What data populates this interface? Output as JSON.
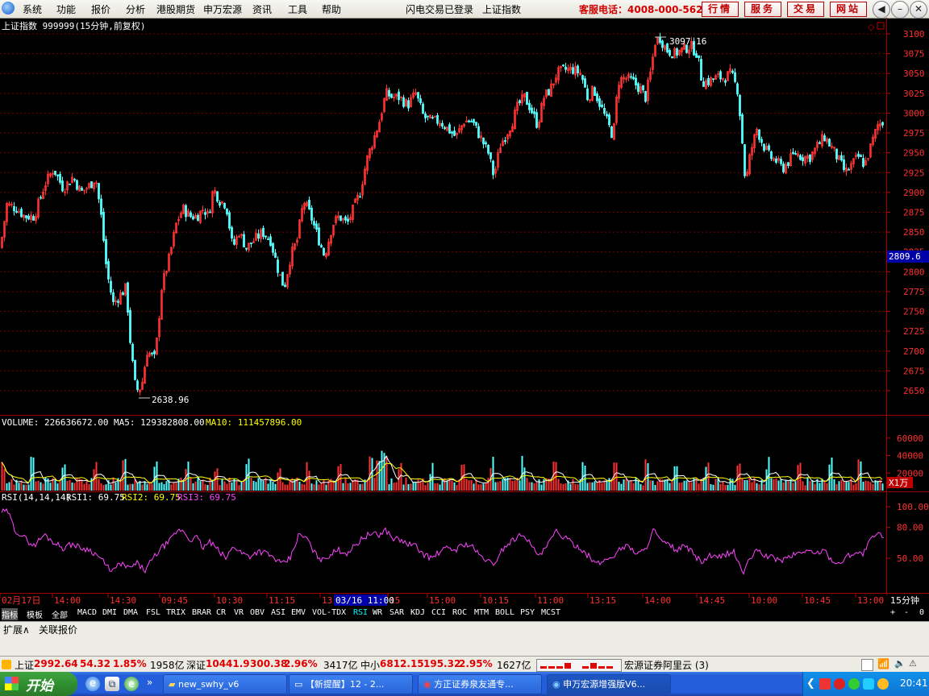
{
  "menubar": {
    "items": [
      "系统",
      "功能",
      "报价",
      "分析",
      "港股期货",
      "申万宏源",
      "资讯",
      "工具",
      "帮助"
    ],
    "flash_login": "闪电交易已登录",
    "index_name": "上证指数",
    "hotline": "客服电话：4008-000-562",
    "buttons": [
      "行情",
      "服务",
      "交易",
      "网站"
    ]
  },
  "price_panel": {
    "title": "上证指数 999999(15分钟,前复权)",
    "high_label": "3097.16",
    "low_label": "2638.96",
    "cursor_price": "2809.6",
    "y_ticks": [
      "3100",
      "3075",
      "3050",
      "3025",
      "3000",
      "2975",
      "2950",
      "2925",
      "2900",
      "2875",
      "2850",
      "2825",
      "2800",
      "2775",
      "2750",
      "2725",
      "2700",
      "2675",
      "2650"
    ]
  },
  "volume_panel": {
    "label_volume": "VOLUME: 226636672.00",
    "label_ma5": "MA5: 129382808.00",
    "label_ma10": "MA10: 111457896.00",
    "y_ticks": [
      "60000",
      "40000",
      "20000"
    ],
    "unit": "X1万"
  },
  "rsi_panel": {
    "label_params": "RSI(14,14,14)",
    "label_rsi1": "RSI1: 69.75",
    "label_rsi2": "RSI2: 69.75",
    "label_rsi3": "RSI3: 69.75",
    "y_ticks": [
      "100.00",
      "80.00",
      "50.00"
    ]
  },
  "time_axis": {
    "labels": [
      "02月17日",
      "14:00",
      "14:30",
      "09:45",
      "10:30",
      "11:15",
      "13",
      "15",
      "15:00",
      "10:15",
      "11:00",
      "13:15",
      "14:00",
      "14:45",
      "10:00",
      "10:45",
      "13:00"
    ],
    "cursor_time": "03/16 11:00",
    "period": "15分钟"
  },
  "indicator_tabs": [
    "指标",
    "模板",
    "全部",
    "MACD",
    "DMI",
    "DMA",
    "FSL",
    "TRIX",
    "BRAR",
    "CR",
    "VR",
    "OBV",
    "ASI",
    "EMV",
    "VOL-TDX",
    "RSI",
    "WR",
    "SAR",
    "KDJ",
    "CCI",
    "ROC",
    "MTM",
    "BOLL",
    "PSY",
    "MCST"
  ],
  "tab_controls": [
    "+",
    "-",
    "0"
  ],
  "ext_bar": [
    "扩展∧",
    "关联报价"
  ],
  "status_bar": {
    "sh_name": "上证",
    "sh_value": "2992.64",
    "sh_change": "54.32",
    "sh_pct": "1.85%",
    "sh_amount": "1958亿",
    "sz_name": "深证",
    "sz_value": "10441.9",
    "sz_change": "300.38",
    "sz_pct": "2.96%",
    "sz_amount": "3417亿",
    "zx_name": "中小",
    "zx_value": "6812.15",
    "zx_change": "195.32",
    "zx_pct": "2.95%",
    "zx_amount": "1627亿",
    "broker": "宏源证券阿里云 (3)"
  },
  "taskbar": {
    "start": "开始",
    "tasks": [
      "new_swhy_v6",
      "【新提醒】12 - 2...",
      "方正证券泉友通专...",
      "申万宏源增强版V6..."
    ],
    "clock": "20:41"
  },
  "chart_data": [
    {
      "type": "candlestick",
      "title": "上证指数 999999(15分钟,前复权)",
      "ylim": [
        2630,
        3110
      ],
      "annotations": [
        {
          "label": "3097.16",
          "kind": "high"
        },
        {
          "label": "2638.96",
          "kind": "low"
        }
      ],
      "close_path": [
        [
          0,
          2830
        ],
        [
          8,
          2885
        ],
        [
          20,
          2880
        ],
        [
          30,
          2870
        ],
        [
          42,
          2870
        ],
        [
          55,
          2910
        ],
        [
          66,
          2930
        ],
        [
          78,
          2905
        ],
        [
          90,
          2920
        ],
        [
          100,
          2900
        ],
        [
          112,
          2910
        ],
        [
          118,
          2920
        ],
        [
          125,
          2870
        ],
        [
          132,
          2800
        ],
        [
          140,
          2760
        ],
        [
          148,
          2770
        ],
        [
          156,
          2780
        ],
        [
          162,
          2700
        ],
        [
          168,
          2650
        ],
        [
          175,
          2655
        ],
        [
          182,
          2700
        ],
        [
          192,
          2690
        ],
        [
          200,
          2780
        ],
        [
          210,
          2820
        ],
        [
          218,
          2860
        ],
        [
          226,
          2880
        ],
        [
          235,
          2870
        ],
        [
          244,
          2870
        ],
        [
          252,
          2880
        ],
        [
          258,
          2870
        ],
        [
          264,
          2905
        ],
        [
          272,
          2890
        ],
        [
          280,
          2885
        ],
        [
          288,
          2830
        ],
        [
          296,
          2850
        ],
        [
          305,
          2830
        ],
        [
          315,
          2840
        ],
        [
          325,
          2850
        ],
        [
          335,
          2840
        ],
        [
          345,
          2800
        ],
        [
          352,
          2780
        ],
        [
          360,
          2820
        ],
        [
          368,
          2840
        ],
        [
          376,
          2890
        ],
        [
          385,
          2870
        ],
        [
          395,
          2840
        ],
        [
          402,
          2820
        ],
        [
          412,
          2860
        ],
        [
          420,
          2870
        ],
        [
          430,
          2860
        ],
        [
          438,
          2880
        ],
        [
          446,
          2900
        ],
        [
          454,
          2940
        ],
        [
          462,
          2965
        ],
        [
          470,
          2990
        ],
        [
          478,
          3025
        ],
        [
          486,
          3020
        ],
        [
          495,
          3020
        ],
        [
          505,
          3010
        ],
        [
          515,
          3025
        ],
        [
          525,
          2995
        ],
        [
          535,
          2990
        ],
        [
          545,
          2990
        ],
        [
          555,
          2980
        ],
        [
          565,
          2970
        ],
        [
          575,
          2990
        ],
        [
          585,
          2990
        ],
        [
          595,
          2970
        ],
        [
          605,
          2950
        ],
        [
          612,
          2920
        ],
        [
          620,
          2960
        ],
        [
          628,
          2975
        ],
        [
          635,
          2990
        ],
        [
          642,
          3010
        ],
        [
          650,
          3020
        ],
        [
          658,
          3005
        ],
        [
          666,
          2985
        ],
        [
          674,
          3020
        ],
        [
          682,
          3030
        ],
        [
          690,
          3050
        ],
        [
          700,
          3055
        ],
        [
          710,
          3055
        ],
        [
          720,
          3050
        ],
        [
          728,
          3020
        ],
        [
          736,
          3030
        ],
        [
          744,
          3010
        ],
        [
          752,
          2990
        ],
        [
          760,
          2970
        ],
        [
          766,
          3040
        ],
        [
          774,
          3045
        ],
        [
          784,
          3040
        ],
        [
          794,
          3030
        ],
        [
          800,
          3020
        ],
        [
          806,
          3050
        ],
        [
          812,
          3090
        ],
        [
          818,
          3095
        ],
        [
          826,
          3080
        ],
        [
          836,
          3075
        ],
        [
          846,
          3080
        ],
        [
          856,
          3085
        ],
        [
          864,
          3075
        ],
        [
          870,
          3040
        ],
        [
          878,
          3040
        ],
        [
          888,
          3045
        ],
        [
          898,
          3045
        ],
        [
          906,
          3050
        ],
        [
          914,
          3030
        ],
        [
          918,
          2990
        ],
        [
          924,
          2910
        ],
        [
          930,
          2950
        ],
        [
          938,
          2980
        ],
        [
          946,
          2960
        ],
        [
          954,
          2945
        ],
        [
          962,
          2940
        ],
        [
          970,
          2930
        ],
        [
          978,
          2940
        ],
        [
          986,
          2950
        ],
        [
          994,
          2945
        ],
        [
          1004,
          2945
        ],
        [
          1014,
          2960
        ],
        [
          1022,
          2970
        ],
        [
          1032,
          2955
        ],
        [
          1040,
          2940
        ],
        [
          1048,
          2925
        ],
        [
          1056,
          2935
        ],
        [
          1064,
          2945
        ],
        [
          1072,
          2935
        ],
        [
          1080,
          2960
        ],
        [
          1088,
          2985
        ],
        [
          1096,
          2990
        ]
      ]
    },
    {
      "type": "bar",
      "title": "VOLUME",
      "ylim": [
        0,
        70000
      ],
      "series": [
        {
          "name": "VOLUME"
        },
        {
          "name": "MA5"
        },
        {
          "name": "MA10"
        }
      ]
    },
    {
      "type": "line",
      "title": "RSI(14,14,14)",
      "ylim": [
        20,
        100
      ],
      "series": [
        {
          "name": "RSI1",
          "values_path": [
            [
              0,
              95
            ],
            [
              10,
              95
            ],
            [
              18,
              78
            ],
            [
              30,
              70
            ],
            [
              42,
              62
            ],
            [
              55,
              73
            ],
            [
              66,
              66
            ],
            [
              78,
              60
            ],
            [
              90,
              64
            ],
            [
              100,
              60
            ],
            [
              112,
              58
            ],
            [
              125,
              50
            ],
            [
              132,
              42
            ],
            [
              140,
              38
            ],
            [
              150,
              45
            ],
            [
              160,
              40
            ],
            [
              170,
              45
            ],
            [
              180,
              38
            ],
            [
              190,
              50
            ],
            [
              200,
              60
            ],
            [
              210,
              66
            ],
            [
              218,
              75
            ],
            [
              226,
              78
            ],
            [
              235,
              68
            ],
            [
              244,
              70
            ],
            [
              252,
              60
            ],
            [
              260,
              66
            ],
            [
              270,
              58
            ],
            [
              280,
              50
            ],
            [
              290,
              62
            ],
            [
              300,
              55
            ],
            [
              310,
              52
            ],
            [
              320,
              57
            ],
            [
              330,
              55
            ],
            [
              340,
              50
            ],
            [
              350,
              44
            ],
            [
              360,
              50
            ],
            [
              370,
              72
            ],
            [
              380,
              70
            ],
            [
              390,
              55
            ],
            [
              400,
              48
            ],
            [
              410,
              54
            ],
            [
              420,
              58
            ],
            [
              430,
              55
            ],
            [
              440,
              62
            ],
            [
              450,
              70
            ],
            [
              460,
              74
            ],
            [
              470,
              72
            ],
            [
              478,
              78
            ],
            [
              486,
              70
            ],
            [
              495,
              68
            ],
            [
              505,
              64
            ],
            [
              515,
              62
            ],
            [
              525,
              54
            ],
            [
              535,
              50
            ],
            [
              545,
              56
            ],
            [
              555,
              60
            ],
            [
              565,
              58
            ],
            [
              575,
              64
            ],
            [
              585,
              62
            ],
            [
              595,
              52
            ],
            [
              605,
              48
            ],
            [
              612,
              42
            ],
            [
              620,
              56
            ],
            [
              630,
              64
            ],
            [
              640,
              70
            ],
            [
              650,
              74
            ],
            [
              660,
              60
            ],
            [
              670,
              52
            ],
            [
              680,
              64
            ],
            [
              690,
              76
            ],
            [
              700,
              70
            ],
            [
              710,
              64
            ],
            [
              720,
              60
            ],
            [
              730,
              52
            ],
            [
              740,
              44
            ],
            [
              750,
              48
            ],
            [
              760,
              52
            ],
            [
              770,
              60
            ],
            [
              780,
              62
            ],
            [
              790,
              54
            ],
            [
              800,
              58
            ],
            [
              810,
              78
            ],
            [
              820,
              66
            ],
            [
              830,
              62
            ],
            [
              840,
              58
            ],
            [
              850,
              62
            ],
            [
              860,
              54
            ],
            [
              870,
              46
            ],
            [
              880,
              52
            ],
            [
              890,
              50
            ],
            [
              900,
              54
            ],
            [
              910,
              56
            ],
            [
              916,
              46
            ],
            [
              922,
              35
            ],
            [
              930,
              50
            ],
            [
              940,
              58
            ],
            [
              950,
              52
            ],
            [
              960,
              50
            ],
            [
              970,
              48
            ],
            [
              980,
              52
            ],
            [
              990,
              55
            ],
            [
              1000,
              58
            ],
            [
              1010,
              54
            ],
            [
              1020,
              58
            ],
            [
              1030,
              50
            ],
            [
              1040,
              44
            ],
            [
              1050,
              52
            ],
            [
              1060,
              56
            ],
            [
              1070,
              54
            ],
            [
              1080,
              68
            ],
            [
              1088,
              74
            ],
            [
              1096,
              70
            ]
          ]
        }
      ]
    }
  ]
}
